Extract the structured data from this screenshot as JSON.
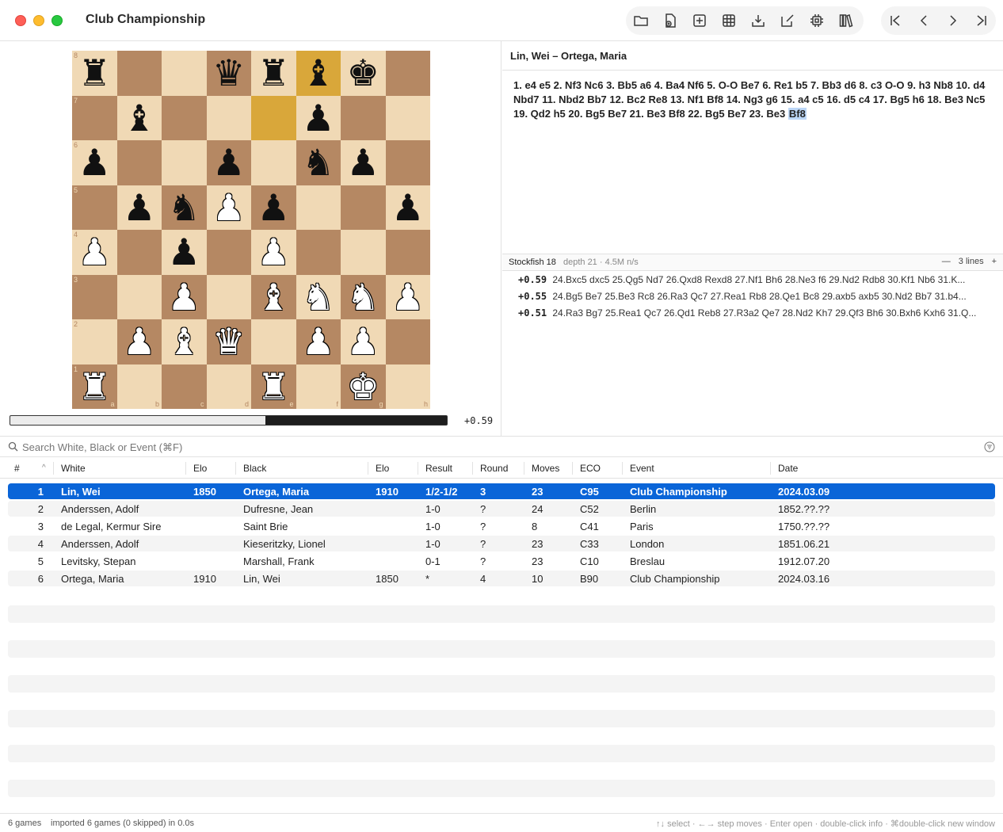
{
  "window": {
    "title": "Club Championship"
  },
  "toolbar": {
    "group1": [
      "open-folder-icon",
      "new-file-icon",
      "add-icon",
      "grid-icon",
      "import-icon",
      "edit-icon",
      "engine-chip-icon",
      "library-icon"
    ],
    "group2": [
      "first-move-icon",
      "previous-move-icon",
      "next-move-icon",
      "last-move-icon"
    ]
  },
  "board": {
    "orientation": "white",
    "highlight": [
      "e7",
      "f8"
    ],
    "rank_labels": [
      "8",
      "7",
      "6",
      "5",
      "4",
      "3",
      "2",
      "1"
    ],
    "file_labels": [
      "a",
      "b",
      "c",
      "d",
      "e",
      "f",
      "g",
      "h"
    ],
    "colors": {
      "light": "#f0d9b5",
      "dark": "#b58863",
      "highlight": "#d9a73a"
    },
    "pieces": {
      "a8": "bR",
      "d8": "bQ",
      "e8": "bR",
      "f8": "bB",
      "g8": "bK",
      "b7": "bB",
      "f7": "bP",
      "a6": "bP",
      "d6": "bP",
      "f6": "bN",
      "g6": "bP",
      "b5": "bP",
      "c5": "bN",
      "d5": "wP",
      "e5": "bP",
      "h5": "bP",
      "a4": "wP",
      "c4": "bP",
      "e4": "wP",
      "c3": "wP",
      "e3": "wB",
      "f3": "wN",
      "g3": "wN",
      "h3": "wP",
      "b2": "wP",
      "c2": "wB",
      "d2": "wQ",
      "f2": "wP",
      "g2": "wP",
      "a1": "wR",
      "e1": "wR",
      "g1": "wK"
    },
    "eval": {
      "text": "+0.59",
      "white_fraction": 0.585
    }
  },
  "game": {
    "header": "Lin, Wei – Ortega, Maria",
    "moves_text": "1. e4 e5 2. Nf3 Nc6 3. Bb5 a6 4. Ba4 Nf6 5. O-O Be7 6. Re1 b5 7. Bb3 d6 8. c3 O-O 9. h3 Nb8 10. d4 Nbd7 11. Nbd2 Bb7 12. Bc2 Re8 13. Nf1 Bf8 14. Ng3 g6 15. a4 c5 16. d5 c4 17. Bg5 h6 18. Be3 Nc5 19. Qd2 h5 20. Bg5 Be7 21. Be3 Bf8 22. Bg5 Be7 23. Be3",
    "current_move": "Bf8"
  },
  "engine": {
    "name": "Stockfish 18",
    "info": "depth 21 · 4.5M n/s",
    "minus_label": "—",
    "lines_label": "3 lines",
    "plus_label": "+",
    "lines": [
      {
        "score": "+0.59",
        "pv": "24.Bxc5 dxc5 25.Qg5 Nd7 26.Qxd8 Rexd8 27.Nf1 Bh6 28.Ne3 f6 29.Nd2 Rdb8 30.Kf1 Nb6 31.K..."
      },
      {
        "score": "+0.55",
        "pv": "24.Bg5 Be7 25.Be3 Rc8 26.Ra3 Qc7 27.Rea1 Rb8 28.Qe1 Bc8 29.axb5 axb5 30.Nd2 Bb7 31.b4..."
      },
      {
        "score": "+0.51",
        "pv": "24.Ra3 Bg7 25.Rea1 Qc7 26.Qd1 Reb8 27.R3a2 Qe7 28.Nd2 Kh7 29.Qf3 Bh6 30.Bxh6 Kxh6 31.Q..."
      }
    ]
  },
  "search": {
    "placeholder": "Search White, Black or Event (⌘F)",
    "value": ""
  },
  "table": {
    "columns": [
      "#",
      "White",
      "Elo",
      "Black",
      "Elo",
      "Result",
      "Round",
      "Moves",
      "ECO",
      "Event",
      "Date"
    ],
    "sort_indicator": "^",
    "rows": [
      {
        "n": "1",
        "white": "Lin, Wei",
        "welo": "1850",
        "black": "Ortega, Maria",
        "belo": "1910",
        "result": "1/2-1/2",
        "round": "3",
        "moves": "23",
        "eco": "C95",
        "event": "Club Championship",
        "date": "2024.03.09",
        "selected": true
      },
      {
        "n": "2",
        "white": "Anderssen, Adolf",
        "welo": "",
        "black": "Dufresne, Jean",
        "belo": "",
        "result": "1-0",
        "round": "?",
        "moves": "24",
        "eco": "C52",
        "event": "Berlin",
        "date": "1852.??.??",
        "selected": false
      },
      {
        "n": "3",
        "white": "de Legal, Kermur Sire",
        "welo": "",
        "black": "Saint Brie",
        "belo": "",
        "result": "1-0",
        "round": "?",
        "moves": "8",
        "eco": "C41",
        "event": "Paris",
        "date": "1750.??.??",
        "selected": false
      },
      {
        "n": "4",
        "white": "Anderssen, Adolf",
        "welo": "",
        "black": "Kieseritzky, Lionel",
        "belo": "",
        "result": "1-0",
        "round": "?",
        "moves": "23",
        "eco": "C33",
        "event": "London",
        "date": "1851.06.21",
        "selected": false
      },
      {
        "n": "5",
        "white": "Levitsky, Stepan",
        "welo": "",
        "black": "Marshall, Frank",
        "belo": "",
        "result": "0-1",
        "round": "?",
        "moves": "23",
        "eco": "C10",
        "event": "Breslau",
        "date": "1912.07.20",
        "selected": false
      },
      {
        "n": "6",
        "white": "Ortega, Maria",
        "welo": "1910",
        "black": "Lin, Wei",
        "belo": "1850",
        "result": "*",
        "round": "4",
        "moves": "10",
        "eco": "B90",
        "event": "Club Championship",
        "date": "2024.03.16",
        "selected": false
      }
    ]
  },
  "status": {
    "count": "6 games",
    "import_msg": "imported 6 games (0 skipped) in 0.0s",
    "hints": "↑↓ select · ←→ step moves · Enter open · double-click info · ⌘double-click new window"
  },
  "colors": {
    "selection": "#0a65d8",
    "accent_highlight": "#bcd7f7"
  }
}
